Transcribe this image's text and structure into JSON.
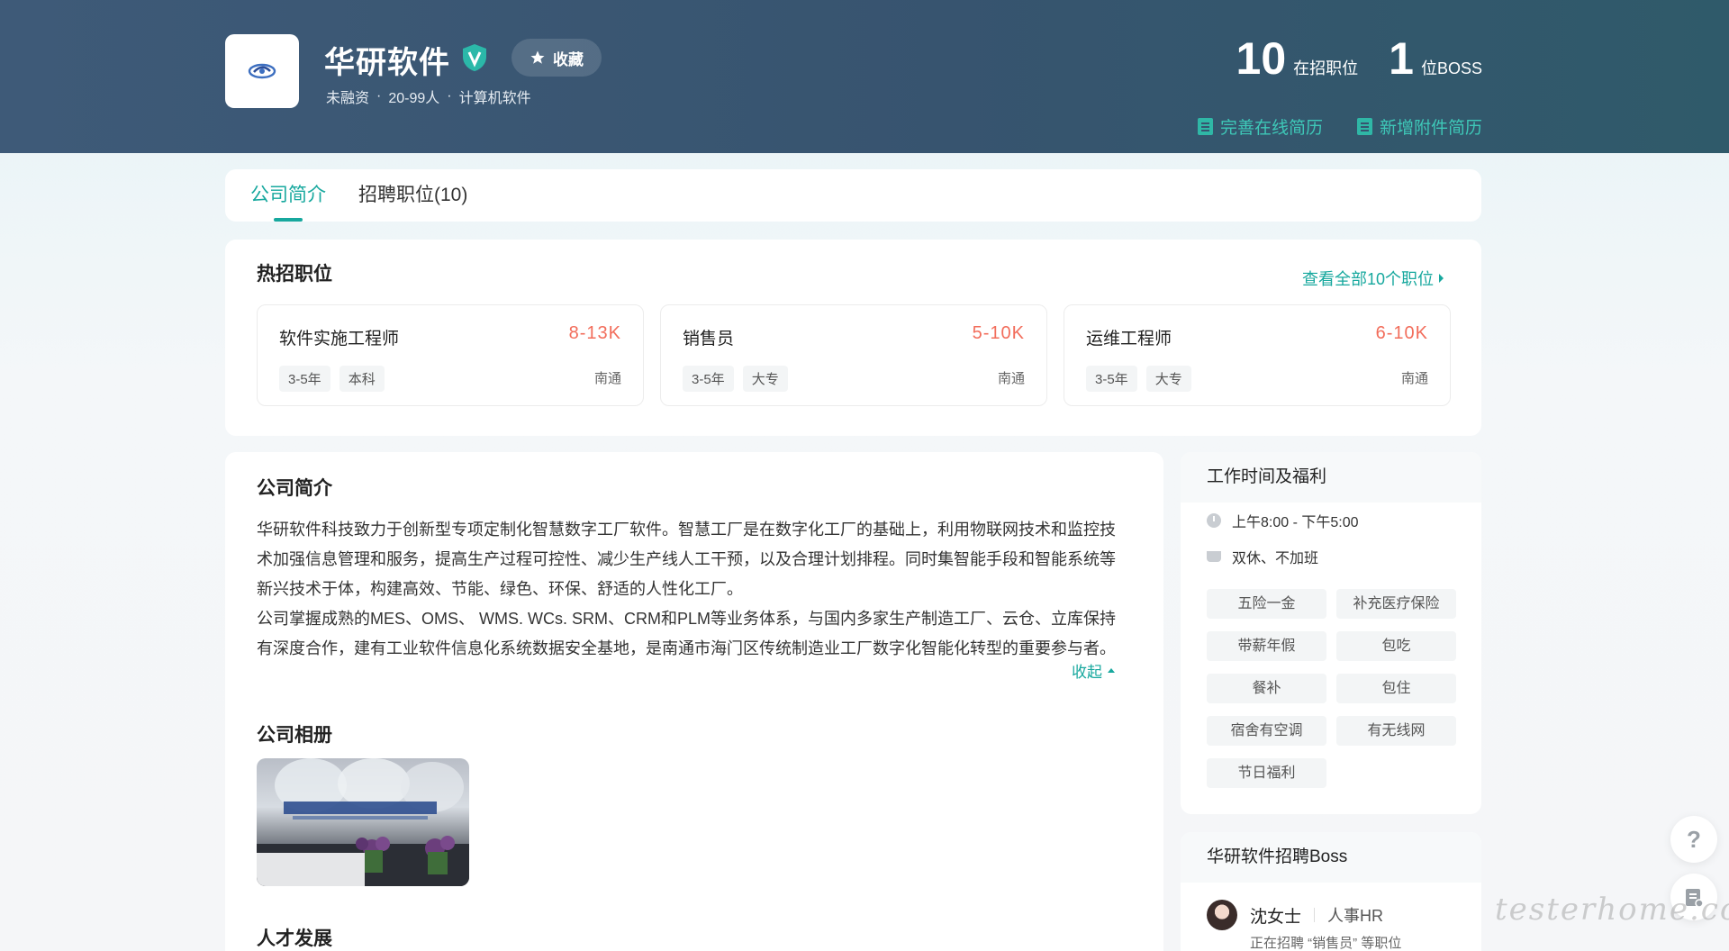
{
  "company": {
    "name": "华研软件",
    "favorite_label": "收藏",
    "funding": "未融资",
    "size": "20-99人",
    "industry": "计算机软件",
    "meta_separator": "·"
  },
  "stats": {
    "jobs_count": "10",
    "jobs_label": "在招职位",
    "boss_count": "1",
    "boss_label": "位BOSS"
  },
  "resume_links": {
    "online": "完善在线简历",
    "attachment": "新增附件简历"
  },
  "tabs": [
    {
      "label": "公司简介",
      "active": true
    },
    {
      "label": "招聘职位(10)",
      "active": false
    }
  ],
  "hot_jobs": {
    "title": "热招职位",
    "view_all": "查看全部10个职位",
    "jobs": [
      {
        "title": "软件实施工程师",
        "salary": "8-13K",
        "tags": [
          "3-5年",
          "本科"
        ],
        "city": "南通"
      },
      {
        "title": "销售员",
        "salary": "5-10K",
        "tags": [
          "3-5年",
          "大专"
        ],
        "city": "南通"
      },
      {
        "title": "运维工程师",
        "salary": "6-10K",
        "tags": [
          "3-5年",
          "大专"
        ],
        "city": "南通"
      }
    ]
  },
  "intro": {
    "title": "公司简介",
    "para1": "华研软件科技致力于创新型专项定制化智慧数字工厂软件。智慧工厂是在数字化工厂的基础上，利用物联网技术和监控技术加强信息管理和服务，提高生产过程可控性、减少生产线人工干预，以及合理计划排程。同时集智能手段和智能系统等新兴技术于体，构建高效、节能、绿色、环保、舒适的人性化工厂。",
    "para2": "公司掌握成熟的MES、OMS、 WMS. WCs. SRM、CRM和PLM等业务体系，与国内多家生产制造工厂、云仓、立库保持有深度合作，建有工业软件信息化系统数据安全基地，是南通市海门区传统制造业工厂数字化智能化转型的重要参与者。",
    "collapse": "收起",
    "album_title": "公司相册",
    "talent_title": "人才发展"
  },
  "welfare": {
    "title": "工作时间及福利",
    "hours": "上午8:00 - 下午5:00",
    "rest": "双休、不加班",
    "benefits": [
      "五险一金",
      "补充医疗保险",
      "带薪年假",
      "包吃",
      "餐补",
      "包住",
      "宿舍有空调",
      "有无线网",
      "节日福利"
    ]
  },
  "boss": {
    "title": "华研软件招聘Boss",
    "name": "沈女士",
    "role": "人事HR",
    "recruiting": "正在招聘 “销售员” 等职位"
  },
  "watermark": "testerhome.com",
  "colors": {
    "accent": "#17a89e",
    "salary": "#f26d5b",
    "header_bg": "#3e5a78"
  }
}
